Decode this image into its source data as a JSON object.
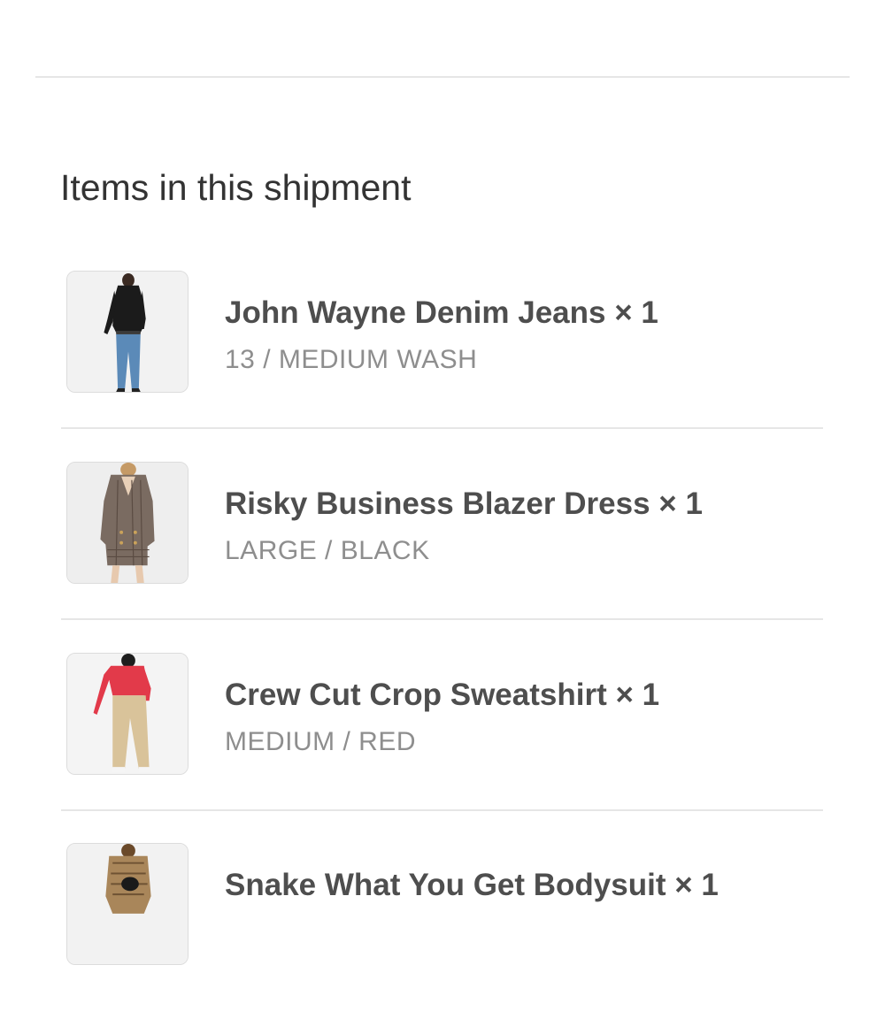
{
  "section_title": "Items in this shipment",
  "items": [
    {
      "name": "John Wayne Denim Jeans",
      "quantity_label": "× 1",
      "variant": "13 / MEDIUM WASH",
      "image": "woman-black-top-blue-jeans-photo"
    },
    {
      "name": "Risky Business Blazer Dress",
      "quantity_label": "× 1",
      "variant": "LARGE / BLACK",
      "image": "woman-plaid-blazer-dress-photo"
    },
    {
      "name": "Crew Cut Crop Sweatshirt",
      "quantity_label": "× 1",
      "variant": "MEDIUM / RED",
      "image": "woman-red-sweatshirt-khaki-pants-photo"
    },
    {
      "name": "Snake What You Get Bodysuit",
      "quantity_label": "× 1",
      "variant": "",
      "image": "woman-snakeprint-bodysuit-photo"
    }
  ],
  "colors": {
    "divider": "#e6e6e6",
    "title_text": "#4e4e4e",
    "variant_text": "#8e8e8e",
    "thumb_border": "#dcdcdc"
  }
}
